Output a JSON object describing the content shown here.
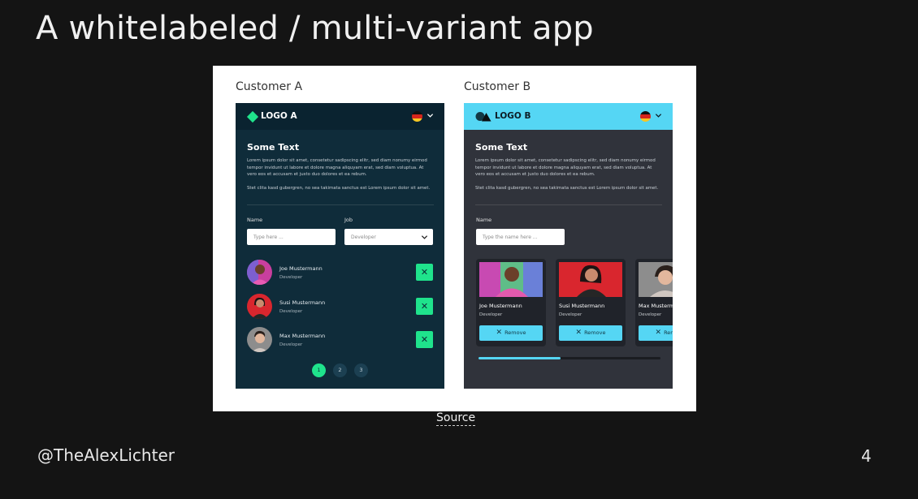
{
  "slide": {
    "title": "A whitelabeled / multi-variant app",
    "source_label": "Source",
    "handle": "@TheAlexLichter",
    "page_number": "4"
  },
  "customer_a": {
    "label": "Customer A",
    "logo_text": "LOGO A",
    "brand_color": "#1fe38c",
    "background_color": "#0f2c3a",
    "content_title": "Some Text",
    "lorem_1": "Lorem ipsum dolor sit amet, consetetur sadipscing elitr, sed diam nonumy eirmod tempor invidunt ut labore et dolore magna aliquyam erat, sed diam voluptua. At vero eos et accusam et justo duo dolores et ea rebum.",
    "lorem_2": "Stet clita kasd gubergren, no sea takimata sanctus est Lorem ipsum dolor sit amet.",
    "name_label": "Name",
    "name_placeholder": "Type here ...",
    "job_label": "Job",
    "job_value": "Developer",
    "people": [
      {
        "name": "Joe Mustermann",
        "role": "Developer"
      },
      {
        "name": "Susi Mustermann",
        "role": "Developer"
      },
      {
        "name": "Max Mustermann",
        "role": "Developer"
      }
    ],
    "remove_icon": "close-icon",
    "pages": [
      "1",
      "2",
      "3"
    ],
    "active_page": "1"
  },
  "customer_b": {
    "label": "Customer B",
    "logo_text": "LOGO B",
    "brand_color": "#55d6f4",
    "background_color": "#30333b",
    "content_title": "Some Text",
    "lorem_1": "Lorem ipsum dolor sit amet, consetetur sadipscing elitr, sed diam nonumy eirmod tempor invidunt ut labore et dolore magna aliquyam erat, sed diam voluptua. At vero eos et accusam et justo duo dolores et ea rebum.",
    "lorem_2": "Stet clita kasd gubergren, no sea takimata sanctus est Lorem ipsum dolor sit amet.",
    "name_label": "Name",
    "name_placeholder": "Type the name here ...",
    "cards": [
      {
        "name": "Joe Mustermann",
        "role": "Developer",
        "button": "Remove"
      },
      {
        "name": "Susi Mustermann",
        "role": "Developer",
        "button": "Remove"
      },
      {
        "name": "Max Mustermann",
        "role": "Developer",
        "button": "Remove"
      }
    ],
    "scroll_position": 0.45
  }
}
